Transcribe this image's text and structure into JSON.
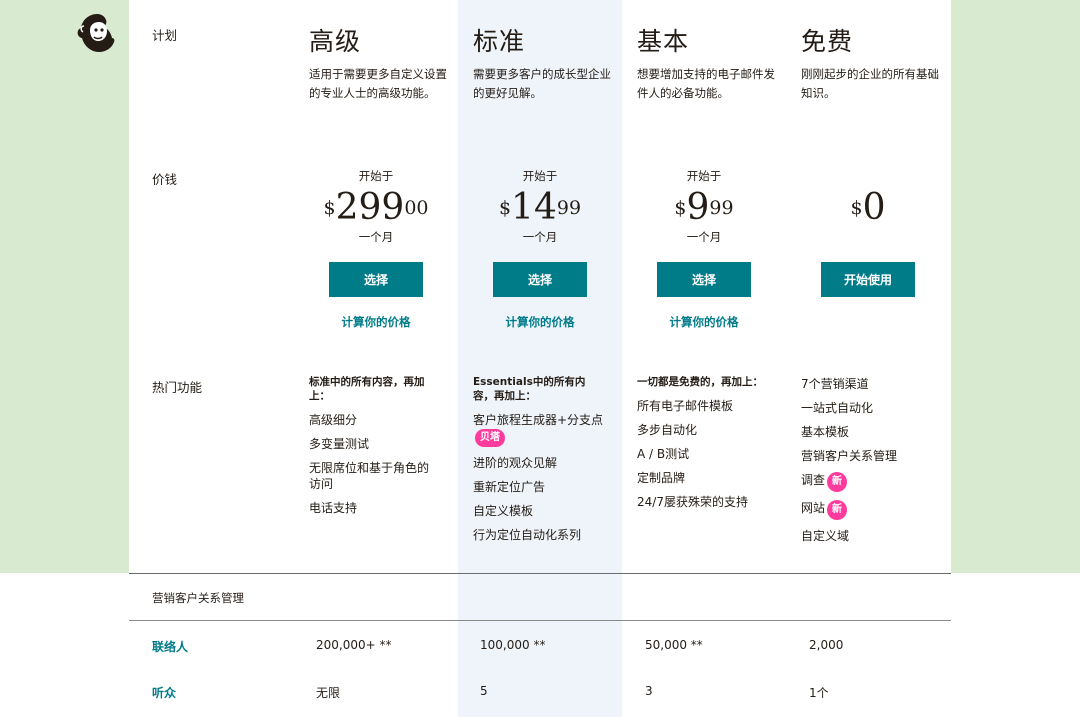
{
  "row_labels": {
    "plan": "计划",
    "price": "价钱",
    "features": "热门功能"
  },
  "plans": [
    {
      "name": "高级",
      "desc": "适用于需要更多自定义设置的专业人士的高级功能。",
      "start": "开始于",
      "currency": "$",
      "price_main": "299",
      "price_cents": "00",
      "per": "一个月",
      "button": "选择",
      "calc": "计算你的价格",
      "feat_intro": "标准中的所有内容，再加上：",
      "features": [
        "高级细分",
        "多变量测试",
        "无限席位和基于角色的访问",
        "电话支持"
      ]
    },
    {
      "name": "标准",
      "desc": "需要更多客户的成长型企业的更好见解。",
      "start": "开始于",
      "currency": "$",
      "price_main": "14",
      "price_cents": "99",
      "per": "一个月",
      "button": "选择",
      "calc": "计算你的价格",
      "feat_intro": "Essentials中的所有内容，再加上：",
      "features": [
        "客户旅程生成器+分支点",
        "进阶的观众见解",
        "重新定位广告",
        "自定义模板",
        "行为定位自动化系列"
      ],
      "beta_badge": "贝塔"
    },
    {
      "name": "基本",
      "desc": "想要增加支持的电子邮件发件人的必备功能。",
      "start": "开始于",
      "currency": "$",
      "price_main": "9",
      "price_cents": "99",
      "per": "一个月",
      "button": "选择",
      "calc": "计算你的价格",
      "feat_intro": "一切都是免费的，再加上：",
      "features": [
        "所有电子邮件模板",
        "多步自动化",
        "A / B测试",
        "定制品牌",
        "24/7屡获殊荣的支持"
      ]
    },
    {
      "name": "免费",
      "desc": "刚刚起步的企业的所有基础知识。",
      "currency": "$",
      "price_main": "0",
      "button": "开始使用",
      "features": [
        "7个营销渠道",
        "一站式自动化",
        "基本模板",
        "营销客户关系管理",
        "调查",
        "网站",
        "自定义域"
      ],
      "new_badge": "新"
    }
  ],
  "crm": {
    "title": "营销客户关系管理",
    "rows": [
      {
        "label": "联络人",
        "values": [
          "200,000+ **",
          "100,000 **",
          "50,000 **",
          "2,000"
        ]
      },
      {
        "label": "听众",
        "values": [
          "无限",
          "5",
          "3",
          "1个"
        ]
      }
    ]
  },
  "colors": {
    "accent": "#007c89",
    "badge": "#ff3c9d",
    "bg_green": "#d8ead0",
    "highlight_col": "#eef4fa"
  }
}
